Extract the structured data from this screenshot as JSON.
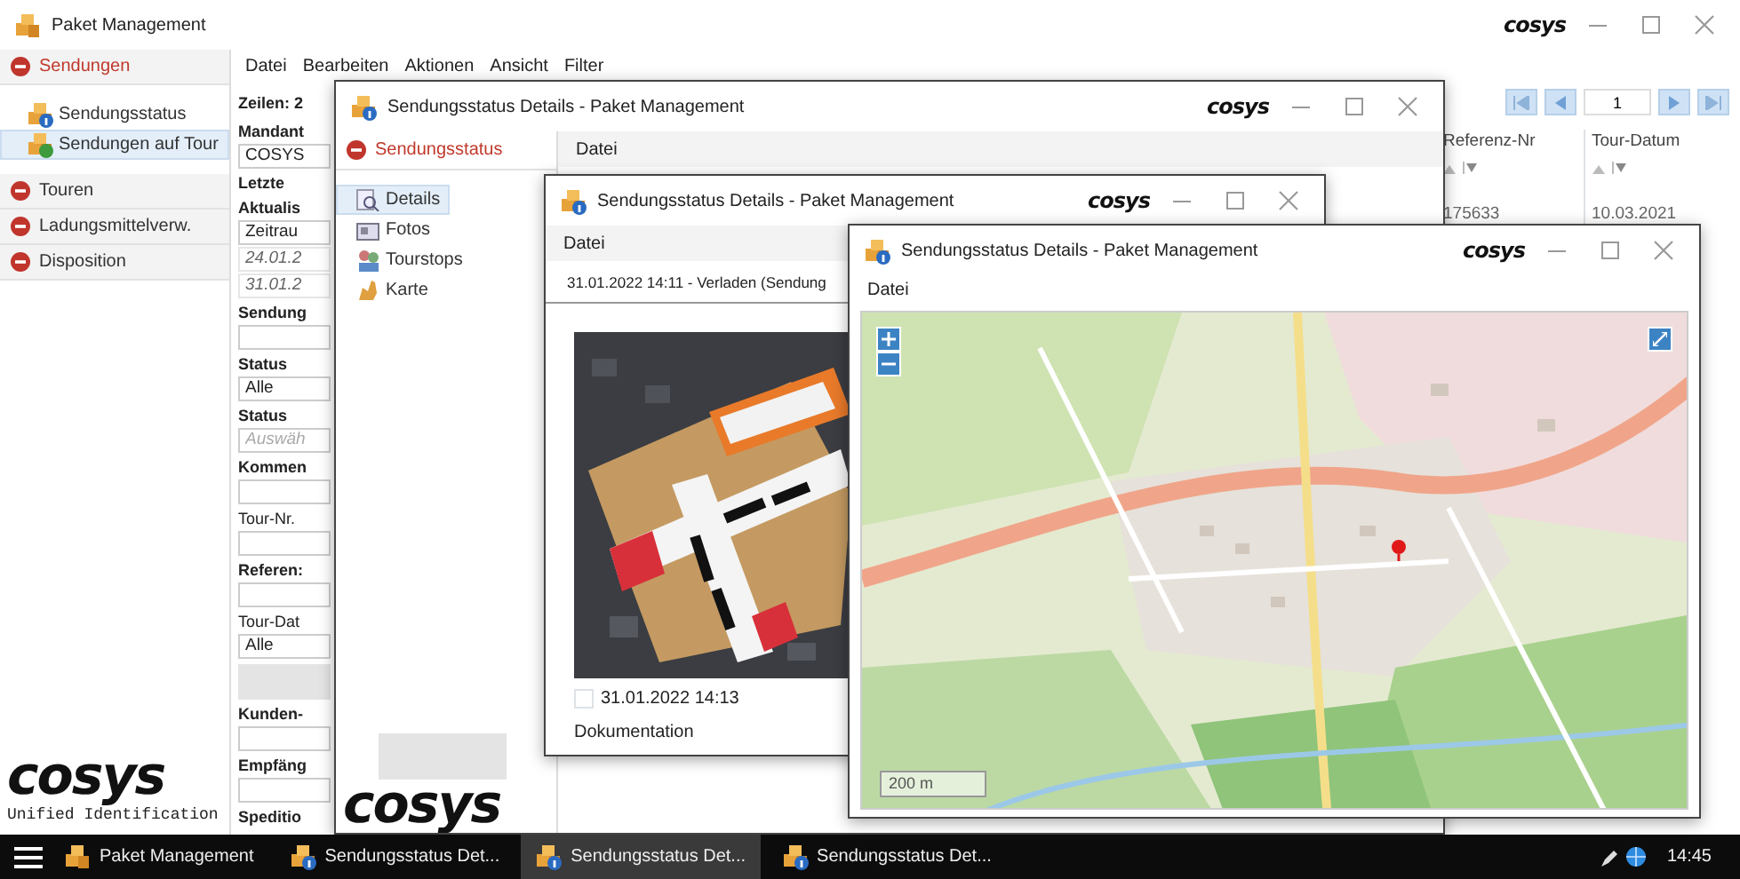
{
  "main_window": {
    "title": "Paket Management",
    "logo": "cosys",
    "sidebar": {
      "groups": [
        {
          "label": "Sendungen",
          "expanded": true,
          "items": [
            {
              "label": "Sendungsstatus",
              "selected": false
            },
            {
              "label": "Sendungen auf Tour",
              "selected": true
            }
          ]
        },
        {
          "label": "Touren",
          "expanded": false
        },
        {
          "label": "Ladungsmittelverw.",
          "expanded": false
        },
        {
          "label": "Disposition",
          "expanded": false
        }
      ],
      "brand": "cosys",
      "caption": "Unified Identification"
    },
    "menu": [
      "Datei",
      "Bearbeiten",
      "Aktionen",
      "Ansicht",
      "Filter"
    ],
    "row_count": "Zeilen: 2",
    "filters": [
      {
        "kind": "label",
        "text": "Mandant",
        "bold": true
      },
      {
        "kind": "field",
        "value": "COSYS"
      },
      {
        "kind": "label",
        "text": "Letzte",
        "bold": true
      },
      {
        "kind": "label",
        "text": "Aktualis",
        "bold": true
      },
      {
        "kind": "field",
        "value": "Zeitrau"
      },
      {
        "kind": "date",
        "value": "24.01.2"
      },
      {
        "kind": "date",
        "value": "31.01.2"
      },
      {
        "kind": "label",
        "text": "Sendung",
        "bold": true
      },
      {
        "kind": "field"
      },
      {
        "kind": "label",
        "text": "Status",
        "bold": true
      },
      {
        "kind": "field",
        "value": "Alle"
      },
      {
        "kind": "label",
        "text": "Status",
        "bold": true
      },
      {
        "kind": "field",
        "placeholder": "Auswäh"
      },
      {
        "kind": "label",
        "text": "Kommen",
        "bold": true
      },
      {
        "kind": "field"
      },
      {
        "kind": "label",
        "text": "Tour-Nr.",
        "bold": false
      },
      {
        "kind": "field"
      },
      {
        "kind": "label",
        "text": "Referen:",
        "bold": true
      },
      {
        "kind": "field"
      },
      {
        "kind": "label",
        "text": "Tour-Dat",
        "bold": false
      },
      {
        "kind": "field",
        "value": "Alle"
      },
      {
        "kind": "block"
      },
      {
        "kind": "label",
        "text": "Kunden-",
        "bold": true
      },
      {
        "kind": "field"
      },
      {
        "kind": "label",
        "text": "Empfäng",
        "bold": true
      },
      {
        "kind": "field"
      },
      {
        "kind": "label",
        "text": "Speditio",
        "bold": true
      }
    ],
    "pager": {
      "page": "1"
    },
    "table": {
      "columns": [
        "Referenz-Nr",
        "Tour-Datum"
      ],
      "rows": [
        [
          "175633",
          "10.03.2021"
        ]
      ]
    }
  },
  "details_window": {
    "title": "Sendungsstatus Details - Paket Management",
    "logo": "cosys",
    "sidebar": {
      "header": "Sendungsstatus",
      "items": [
        {
          "label": "Details",
          "selected": true
        },
        {
          "label": "Fotos",
          "selected": false
        },
        {
          "label": "Tourstops",
          "selected": false
        },
        {
          "label": "Karte",
          "selected": false
        }
      ]
    },
    "menu": [
      "Datei"
    ],
    "brand": "cosys"
  },
  "photo_window": {
    "title": "Sendungsstatus Details - Paket Management",
    "logo": "cosys",
    "menu": [
      "Datei"
    ],
    "event": "31.01.2022 14:11 - Verladen (Sendung",
    "photo": {
      "kind": "picture",
      "checked": false,
      "date": "31.01.2022 14:13",
      "caption": "Dokumentation"
    }
  },
  "map_window": {
    "title": "Sendungsstatus Details - Paket Management",
    "logo": "cosys",
    "menu": [
      "Datei"
    ],
    "scale": "200 m"
  },
  "taskbar": {
    "items": [
      {
        "label": "Paket Management",
        "active": false
      },
      {
        "label": "Sendungsstatus Det...",
        "active": false
      },
      {
        "label": "Sendungsstatus Det...",
        "active": true
      },
      {
        "label": "Sendungsstatus Det...",
        "active": false
      }
    ],
    "time": "14:45"
  }
}
